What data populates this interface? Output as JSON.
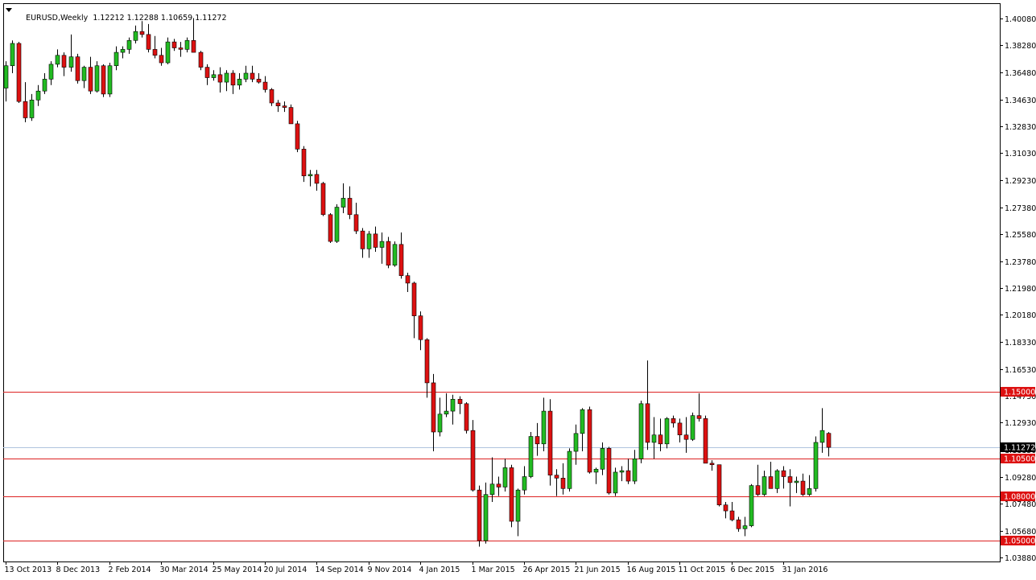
{
  "header": {
    "symbol": "EURUSD,Weekly",
    "ohlc": "1.12212 1.12288 1.10659 1.11272"
  },
  "colors": {
    "bull": "#22bb22",
    "bear": "#dd1111",
    "wick": "#000000",
    "level_line": "#dd2222",
    "level_label_bg": "#dd1111",
    "current_label_bg": "#000000",
    "current_line": "#b0c4de",
    "axis": "#000000"
  },
  "chart_data": {
    "type": "candlestick",
    "title": "EURUSD,Weekly",
    "y_ticks": [
      "1.40080",
      "1.38280",
      "1.36480",
      "1.34630",
      "1.32830",
      "1.31030",
      "1.29230",
      "1.27380",
      "1.25580",
      "1.23780",
      "1.21980",
      "1.20180",
      "1.18330",
      "1.16530",
      "1.14730",
      "1.12930",
      "1.11130",
      "1.09280",
      "1.07480",
      "1.05680",
      "1.03880"
    ],
    "ylim": [
      1.036,
      1.411
    ],
    "x_ticks": [
      {
        "label": "13 Oct 2013",
        "index": 0
      },
      {
        "label": "8 Dec 2013",
        "index": 8
      },
      {
        "label": "2 Feb 2014",
        "index": 16
      },
      {
        "label": "30 Mar 2014",
        "index": 24
      },
      {
        "label": "25 May 2014",
        "index": 32
      },
      {
        "label": "20 Jul 2014",
        "index": 40
      },
      {
        "label": "14 Sep 2014",
        "index": 48
      },
      {
        "label": "9 Nov 2014",
        "index": 56
      },
      {
        "label": "4 Jan 2015",
        "index": 64
      },
      {
        "label": "1 Mar 2015",
        "index": 72
      },
      {
        "label": "26 Apr 2015",
        "index": 80
      },
      {
        "label": "21 Jun 2015",
        "index": 88
      },
      {
        "label": "16 Aug 2015",
        "index": 96
      },
      {
        "label": "11 Oct 2015",
        "index": 104
      },
      {
        "label": "6 Dec 2015",
        "index": 112
      },
      {
        "label": "31 Jan 2016",
        "index": 120
      }
    ],
    "levels": [
      {
        "value": 1.15,
        "label": "1.15000"
      },
      {
        "value": 1.105,
        "label": "1.10500"
      },
      {
        "value": 1.08,
        "label": "1.08000"
      },
      {
        "value": 1.05,
        "label": "1.05000"
      }
    ],
    "current_price": {
      "value": 1.11272,
      "label": "1.11272"
    },
    "candles": [
      [
        1.354,
        1.372,
        1.345,
        1.369
      ],
      [
        1.369,
        1.386,
        1.364,
        1.384
      ],
      [
        1.384,
        1.385,
        1.344,
        1.345
      ],
      [
        1.345,
        1.358,
        1.331,
        1.334
      ],
      [
        1.334,
        1.35,
        1.332,
        1.346
      ],
      [
        1.346,
        1.356,
        1.342,
        1.352
      ],
      [
        1.352,
        1.364,
        1.35,
        1.36
      ],
      [
        1.36,
        1.372,
        1.356,
        1.37
      ],
      [
        1.37,
        1.38,
        1.368,
        1.376
      ],
      [
        1.376,
        1.378,
        1.362,
        1.368
      ],
      [
        1.368,
        1.39,
        1.365,
        1.375
      ],
      [
        1.375,
        1.377,
        1.357,
        1.359
      ],
      [
        1.359,
        1.369,
        1.354,
        1.368
      ],
      [
        1.368,
        1.375,
        1.35,
        1.352
      ],
      [
        1.352,
        1.372,
        1.351,
        1.369
      ],
      [
        1.369,
        1.37,
        1.348,
        1.35
      ],
      [
        1.35,
        1.371,
        1.348,
        1.369
      ],
      [
        1.369,
        1.382,
        1.366,
        1.378
      ],
      [
        1.378,
        1.382,
        1.374,
        1.38
      ],
      [
        1.38,
        1.388,
        1.377,
        1.386
      ],
      [
        1.386,
        1.396,
        1.384,
        1.392
      ],
      [
        1.392,
        1.399,
        1.388,
        1.39
      ],
      [
        1.39,
        1.397,
        1.378,
        1.38
      ],
      [
        1.38,
        1.389,
        1.374,
        1.376
      ],
      [
        1.376,
        1.381,
        1.369,
        1.371
      ],
      [
        1.371,
        1.388,
        1.37,
        1.385
      ],
      [
        1.385,
        1.387,
        1.379,
        1.381
      ],
      [
        1.381,
        1.385,
        1.375,
        1.38
      ],
      [
        1.38,
        1.388,
        1.378,
        1.386
      ],
      [
        1.386,
        1.401,
        1.378,
        1.378
      ],
      [
        1.378,
        1.379,
        1.366,
        1.368
      ],
      [
        1.368,
        1.37,
        1.356,
        1.361
      ],
      [
        1.361,
        1.366,
        1.359,
        1.363
      ],
      [
        1.363,
        1.368,
        1.351,
        1.358
      ],
      [
        1.358,
        1.366,
        1.352,
        1.364
      ],
      [
        1.364,
        1.366,
        1.35,
        1.356
      ],
      [
        1.356,
        1.364,
        1.353,
        1.36
      ],
      [
        1.36,
        1.369,
        1.358,
        1.364
      ],
      [
        1.364,
        1.369,
        1.358,
        1.36
      ],
      [
        1.36,
        1.364,
        1.357,
        1.358
      ],
      [
        1.358,
        1.362,
        1.351,
        1.353
      ],
      [
        1.353,
        1.354,
        1.342,
        1.344
      ],
      [
        1.344,
        1.346,
        1.338,
        1.342
      ],
      [
        1.342,
        1.345,
        1.338,
        1.341
      ],
      [
        1.341,
        1.343,
        1.33,
        1.33
      ],
      [
        1.33,
        1.332,
        1.311,
        1.313
      ],
      [
        1.313,
        1.315,
        1.291,
        1.295
      ],
      [
        1.295,
        1.299,
        1.288,
        1.296
      ],
      [
        1.296,
        1.299,
        1.285,
        1.29
      ],
      [
        1.29,
        1.291,
        1.268,
        1.269
      ],
      [
        1.269,
        1.27,
        1.25,
        1.251
      ],
      [
        1.251,
        1.276,
        1.25,
        1.274
      ],
      [
        1.274,
        1.29,
        1.27,
        1.28
      ],
      [
        1.28,
        1.288,
        1.266,
        1.269
      ],
      [
        1.269,
        1.277,
        1.256,
        1.258
      ],
      [
        1.258,
        1.26,
        1.24,
        1.246
      ],
      [
        1.246,
        1.258,
        1.24,
        1.256
      ],
      [
        1.256,
        1.261,
        1.244,
        1.247
      ],
      [
        1.247,
        1.257,
        1.236,
        1.251
      ],
      [
        1.251,
        1.254,
        1.233,
        1.235
      ],
      [
        1.235,
        1.251,
        1.234,
        1.249
      ],
      [
        1.249,
        1.257,
        1.226,
        1.228
      ],
      [
        1.228,
        1.23,
        1.217,
        1.223
      ],
      [
        1.223,
        1.224,
        1.186,
        1.201
      ],
      [
        1.201,
        1.204,
        1.178,
        1.185
      ],
      [
        1.185,
        1.186,
        1.146,
        1.156
      ],
      [
        1.156,
        1.162,
        1.11,
        1.123
      ],
      [
        1.123,
        1.146,
        1.12,
        1.135
      ],
      [
        1.135,
        1.149,
        1.133,
        1.137
      ],
      [
        1.137,
        1.148,
        1.128,
        1.145
      ],
      [
        1.145,
        1.147,
        1.135,
        1.142
      ],
      [
        1.142,
        1.143,
        1.122,
        1.124
      ],
      [
        1.124,
        1.131,
        1.083,
        1.084
      ],
      [
        1.084,
        1.087,
        1.046,
        1.05
      ],
      [
        1.05,
        1.089,
        1.048,
        1.081
      ],
      [
        1.081,
        1.106,
        1.076,
        1.088
      ],
      [
        1.088,
        1.093,
        1.08,
        1.086
      ],
      [
        1.086,
        1.105,
        1.083,
        1.099
      ],
      [
        1.099,
        1.101,
        1.059,
        1.063
      ],
      [
        1.063,
        1.085,
        1.053,
        1.084
      ],
      [
        1.084,
        1.1,
        1.081,
        1.093
      ],
      [
        1.093,
        1.123,
        1.092,
        1.12
      ],
      [
        1.12,
        1.129,
        1.107,
        1.115
      ],
      [
        1.115,
        1.146,
        1.11,
        1.137
      ],
      [
        1.137,
        1.145,
        1.087,
        1.094
      ],
      [
        1.094,
        1.098,
        1.08,
        1.092
      ],
      [
        1.092,
        1.102,
        1.081,
        1.085
      ],
      [
        1.085,
        1.112,
        1.083,
        1.11
      ],
      [
        1.11,
        1.128,
        1.101,
        1.122
      ],
      [
        1.122,
        1.139,
        1.11,
        1.138
      ],
      [
        1.138,
        1.14,
        1.095,
        1.096
      ],
      [
        1.096,
        1.099,
        1.088,
        1.098
      ],
      [
        1.098,
        1.116,
        1.094,
        1.112
      ],
      [
        1.112,
        1.113,
        1.081,
        1.082
      ],
      [
        1.082,
        1.099,
        1.08,
        1.096
      ],
      [
        1.096,
        1.1,
        1.09,
        1.097
      ],
      [
        1.097,
        1.105,
        1.088,
        1.09
      ],
      [
        1.09,
        1.111,
        1.088,
        1.105
      ],
      [
        1.105,
        1.144,
        1.102,
        1.142
      ],
      [
        1.142,
        1.171,
        1.111,
        1.116
      ],
      [
        1.116,
        1.133,
        1.105,
        1.121
      ],
      [
        1.121,
        1.132,
        1.11,
        1.115
      ],
      [
        1.115,
        1.133,
        1.112,
        1.132
      ],
      [
        1.132,
        1.134,
        1.126,
        1.129
      ],
      [
        1.129,
        1.132,
        1.116,
        1.121
      ],
      [
        1.121,
        1.133,
        1.109,
        1.118
      ],
      [
        1.118,
        1.136,
        1.117,
        1.134
      ],
      [
        1.134,
        1.149,
        1.13,
        1.132
      ],
      [
        1.132,
        1.134,
        1.102,
        1.102
      ],
      [
        1.102,
        1.104,
        1.097,
        1.101
      ],
      [
        1.101,
        1.101,
        1.073,
        1.074
      ],
      [
        1.074,
        1.076,
        1.065,
        1.07
      ],
      [
        1.07,
        1.076,
        1.063,
        1.064
      ],
      [
        1.064,
        1.066,
        1.056,
        1.058
      ],
      [
        1.058,
        1.066,
        1.053,
        1.06
      ],
      [
        1.06,
        1.088,
        1.059,
        1.087
      ],
      [
        1.087,
        1.101,
        1.08,
        1.081
      ],
      [
        1.081,
        1.097,
        1.08,
        1.093
      ],
      [
        1.093,
        1.103,
        1.088,
        1.085
      ],
      [
        1.085,
        1.098,
        1.082,
        1.097
      ],
      [
        1.097,
        1.1,
        1.085,
        1.093
      ],
      [
        1.093,
        1.098,
        1.073,
        1.089
      ],
      [
        1.089,
        1.093,
        1.082,
        1.09
      ],
      [
        1.09,
        1.095,
        1.08,
        1.081
      ],
      [
        1.081,
        1.094,
        1.08,
        1.085
      ],
      [
        1.085,
        1.12,
        1.083,
        1.116
      ],
      [
        1.116,
        1.139,
        1.109,
        1.124
      ],
      [
        1.1221,
        1.1229,
        1.1066,
        1.1127
      ]
    ]
  }
}
